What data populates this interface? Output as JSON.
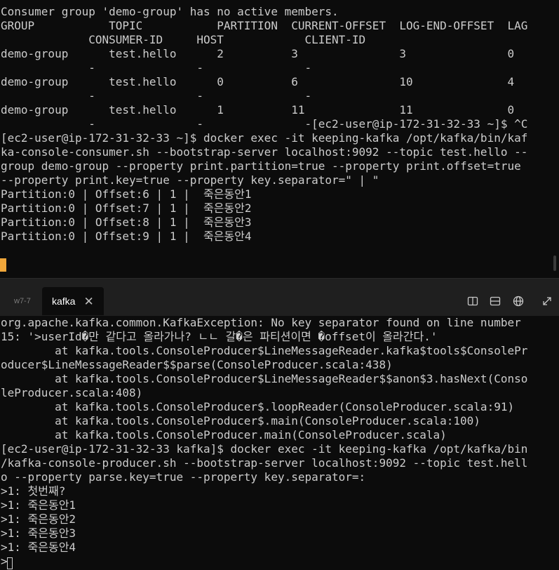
{
  "top_terminal": {
    "lines": [
      "Consumer group 'demo-group' has no active members.",
      "",
      "GROUP           TOPIC           PARTITION  CURRENT-OFFSET  LOG-END-OFFSET  LAG",
      "             CONSUMER-ID     HOST            CLIENT-ID",
      "demo-group      test.hello      2          3               3               0",
      "             -               -               -",
      "demo-group      test.hello      0          6               10              4",
      "             -               -               -",
      "demo-group      test.hello      1          11              11              0",
      "             -               -               -[ec2-user@ip-172-31-32-33 ~]$ ^C",
      "[ec2-user@ip-172-31-32-33 ~]$ docker exec -it keeping-kafka /opt/kafka/bin/kaf",
      "ka-console-consumer.sh --bootstrap-server localhost:9092 --topic test.hello --",
      "group demo-group --property print.partition=true --property print.offset=true",
      "--property print.key=true --property key.separator=\" | \"",
      "Partition:0 | Offset:6 | 1 |  죽은동안1",
      "Partition:0 | Offset:7 | 1 |  죽은동안2",
      "Partition:0 | Offset:8 | 1 |  죽은동안3",
      "Partition:0 | Offset:9 | 1 |  죽은동안4"
    ]
  },
  "tab_bar": {
    "tabs": [
      {
        "label": "w7-7",
        "active": false
      },
      {
        "label": "kafka",
        "active": true
      }
    ],
    "close_glyph": "✕",
    "icons": [
      "split-vertical-icon",
      "split-horizontal-icon",
      "globe-icon",
      "expand-icon"
    ]
  },
  "bottom_terminal": {
    "lines": [
      "org.apache.kafka.common.KafkaException: No key separator found on line number",
      "15: '>userId�만 같다고 올라가나? ㄴㄴ 갈�은 파티션이면 �offset이 올라간다.'",
      "        at kafka.tools.ConsoleProducer$LineMessageReader.kafka$tools$ConsolePr",
      "oducer$LineMessageReader$$parse(ConsoleProducer.scala:438)",
      "        at kafka.tools.ConsoleProducer$LineMessageReader$$anon$3.hasNext(Conso",
      "leProducer.scala:408)",
      "        at kafka.tools.ConsoleProducer$.loopReader(ConsoleProducer.scala:91)",
      "        at kafka.tools.ConsoleProducer$.main(ConsoleProducer.scala:100)",
      "        at kafka.tools.ConsoleProducer.main(ConsoleProducer.scala)",
      "[ec2-user@ip-172-31-32-33 kafka]$ docker exec -it keeping-kafka /opt/kafka/bin",
      "/kafka-console-producer.sh --bootstrap-server localhost:9092 --topic test.hell",
      "o --property parse.key=true --property key.separator=:",
      ">1: 첫번째?",
      ">1: 죽은동안1",
      ">1: 죽은동안2",
      ">1: 죽은동안3",
      ">1: 죽은동안4",
      ">"
    ]
  },
  "colors": {
    "background": "#0c0c0c",
    "text": "#cccccc",
    "tab_bar": "#1f1f1f",
    "cursor": "#f0a63a"
  }
}
